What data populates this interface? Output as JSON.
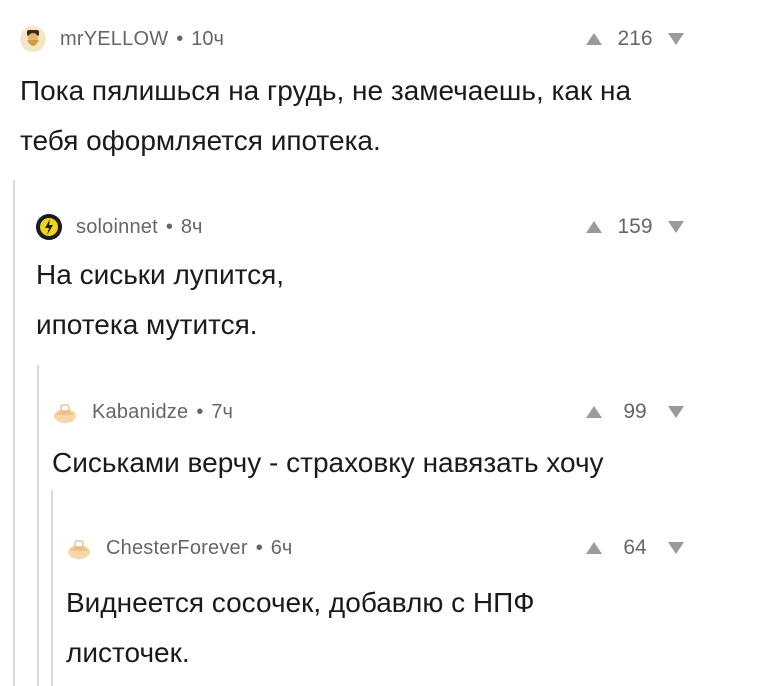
{
  "comments": [
    {
      "author": "mrYELLOW",
      "time": "10ч",
      "score": "216",
      "avatar_icon": "bearded-man-icon",
      "text": "Пока пялишься на грудь, не замечаешь, как на\nтебя оформляется ипотека."
    },
    {
      "author": "soloinnet",
      "time": "8ч",
      "score": "159",
      "avatar_icon": "lightning-emblem-icon",
      "text": "На сиськи лупится,\nипотека мутится."
    },
    {
      "author": "Kabanidze",
      "time": "7ч",
      "score": "99",
      "avatar_icon": "default-avatar-icon",
      "text": "Сиськами верчу - страховку навязать хочу"
    },
    {
      "author": "ChesterForever",
      "time": "6ч",
      "score": "64",
      "avatar_icon": "default-avatar-icon",
      "text": "Виднеется сосочек, добавлю с НПФ\nлисточек."
    }
  ],
  "separator": "•",
  "colors": {
    "text": "#1a1a1a",
    "meta": "#666666",
    "thread": "#d9d9d9",
    "vote": "#9a9a9a"
  }
}
